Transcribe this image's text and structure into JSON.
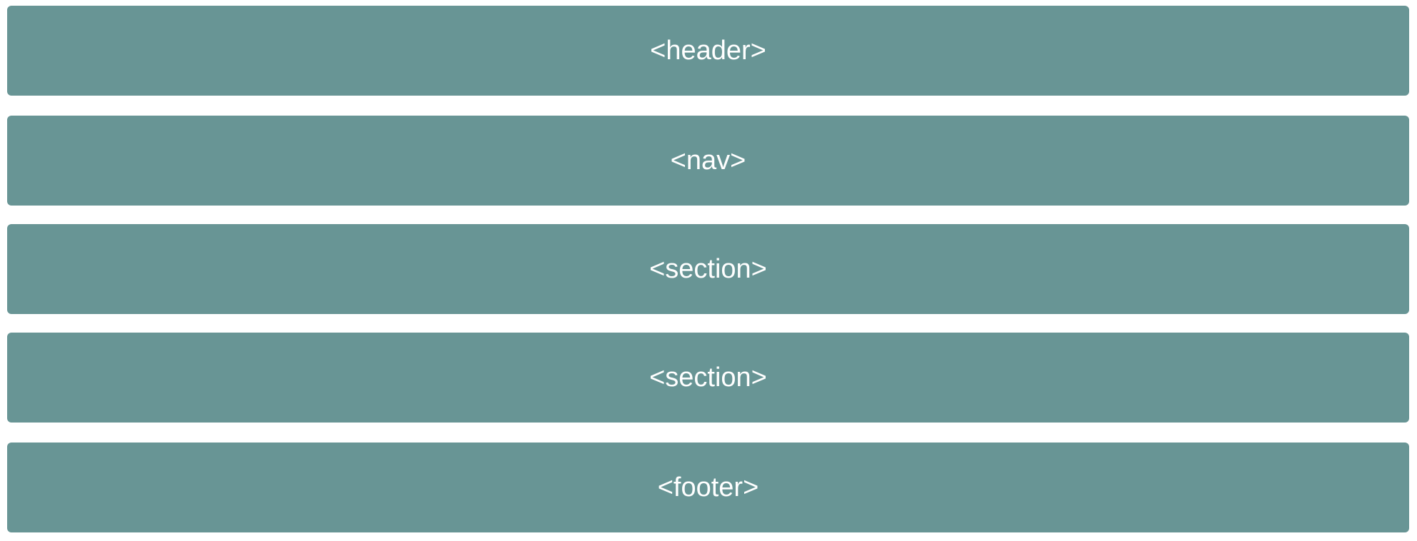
{
  "colors": {
    "block_background": "#689595",
    "block_text": "#ffffff",
    "page_background": "#ffffff"
  },
  "blocks": [
    {
      "label": "<header>"
    },
    {
      "label": "<nav>"
    },
    {
      "label": "<section>"
    },
    {
      "label": "<section>"
    },
    {
      "label": "<footer>"
    }
  ]
}
